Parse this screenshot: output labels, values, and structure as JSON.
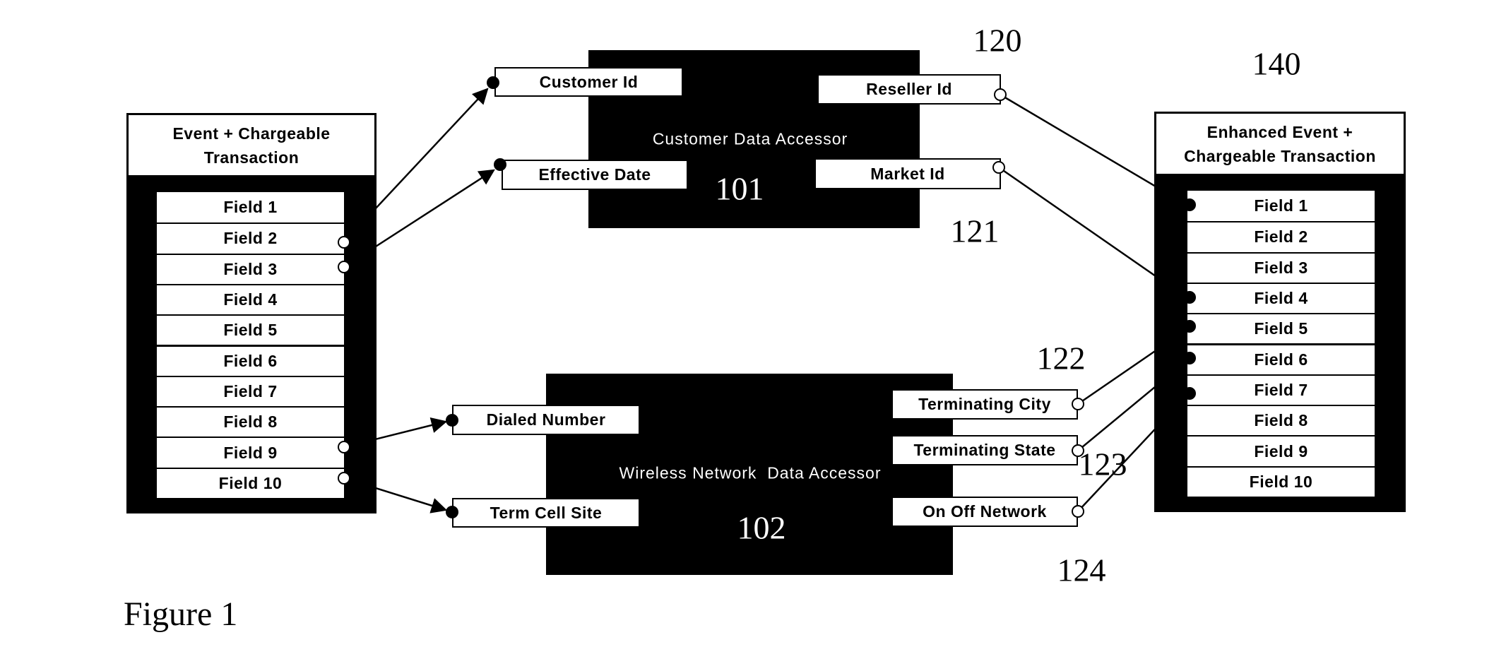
{
  "figure_caption": "Figure 1",
  "source_record": {
    "title_line1": "Event + Chargeable",
    "title_line2": "Transaction",
    "fields": [
      "Field 1",
      "Field 2",
      "Field 3",
      "Field 4",
      "Field 5",
      "Field 6",
      "Field 7",
      "Field 8",
      "Field 9",
      "Field 10"
    ]
  },
  "target_record": {
    "ref": "140",
    "title_line1": "Enhanced Event +",
    "title_line2": "Chargeable Transaction",
    "fields": [
      "Field 1",
      "Field 2",
      "Field 3",
      "Field 4",
      "Field 5",
      "Field 6",
      "Field 7",
      "Field 8",
      "Field 9",
      "Field 10"
    ]
  },
  "customer_accessor": {
    "title": "Customer Data Accessor",
    "ref": "101",
    "inputs": [
      "Customer Id",
      "Effective Date"
    ],
    "outputs": [
      "Reseller Id",
      "Market Id"
    ],
    "output_refs": [
      "120",
      "121"
    ]
  },
  "wireless_accessor": {
    "title": "Wireless Network  Data Accessor",
    "ref": "102",
    "inputs": [
      "Dialed Number",
      "Term Cell Site"
    ],
    "outputs": [
      "Terminating City",
      "Terminating State",
      "On Off Network"
    ],
    "output_refs": [
      "122",
      "123",
      "124"
    ]
  },
  "connections": [
    {
      "from": "Field 2",
      "to": "Customer Id"
    },
    {
      "from": "Field 3",
      "to": "Effective Date"
    },
    {
      "from": "Field 9",
      "to": "Dialed Number"
    },
    {
      "from": "Field 10",
      "to": "Term Cell Site"
    },
    {
      "from": "Reseller Id",
      "to": "Field 1"
    },
    {
      "from": "Market Id",
      "to": "Field 4"
    },
    {
      "from": "Terminating City",
      "to": "Field 5"
    },
    {
      "from": "Terminating State",
      "to": "Field 6"
    },
    {
      "from": "On Off Network",
      "to": "Field 7"
    }
  ]
}
